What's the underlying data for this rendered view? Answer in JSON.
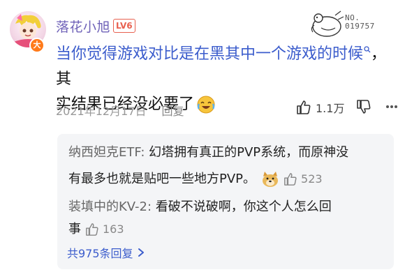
{
  "comment": {
    "username": "落花小旭",
    "level": "LV6",
    "avatar_badge": "大",
    "stamp_number": "NO.\n019757",
    "text_link": "当你觉得游戏对比是在黑其中一个游戏的时候",
    "text_rest_line1": "，其",
    "text_line2": "实结果已经没必要了",
    "date": "2021年12月17日",
    "reply_label": "回复",
    "like_count": "1.1万"
  },
  "replies": [
    {
      "name": "纳西妲克ETF",
      "sep": ": ",
      "line1": "幻塔拥有真正的PVP系统，而原神没",
      "line2": "有最多也就是贴吧一些地方PVP。",
      "likes": "523"
    },
    {
      "name": "装填中的KV-2",
      "sep": ": ",
      "line1": "看破不说破啊，你这个人怎么回",
      "line2": "事",
      "likes": "163"
    }
  ],
  "all_replies_label": "共975条回复",
  "colors": {
    "username": "#6f62b8",
    "level": "#e8604f",
    "link": "#3b5ccc",
    "panel": "#f4f5f7"
  },
  "icons": [
    "search-icon",
    "laugh-cry-emoji",
    "thumbs-up-icon",
    "thumbs-down-icon",
    "more-icon",
    "doge-emoji",
    "chevron-right-icon"
  ]
}
